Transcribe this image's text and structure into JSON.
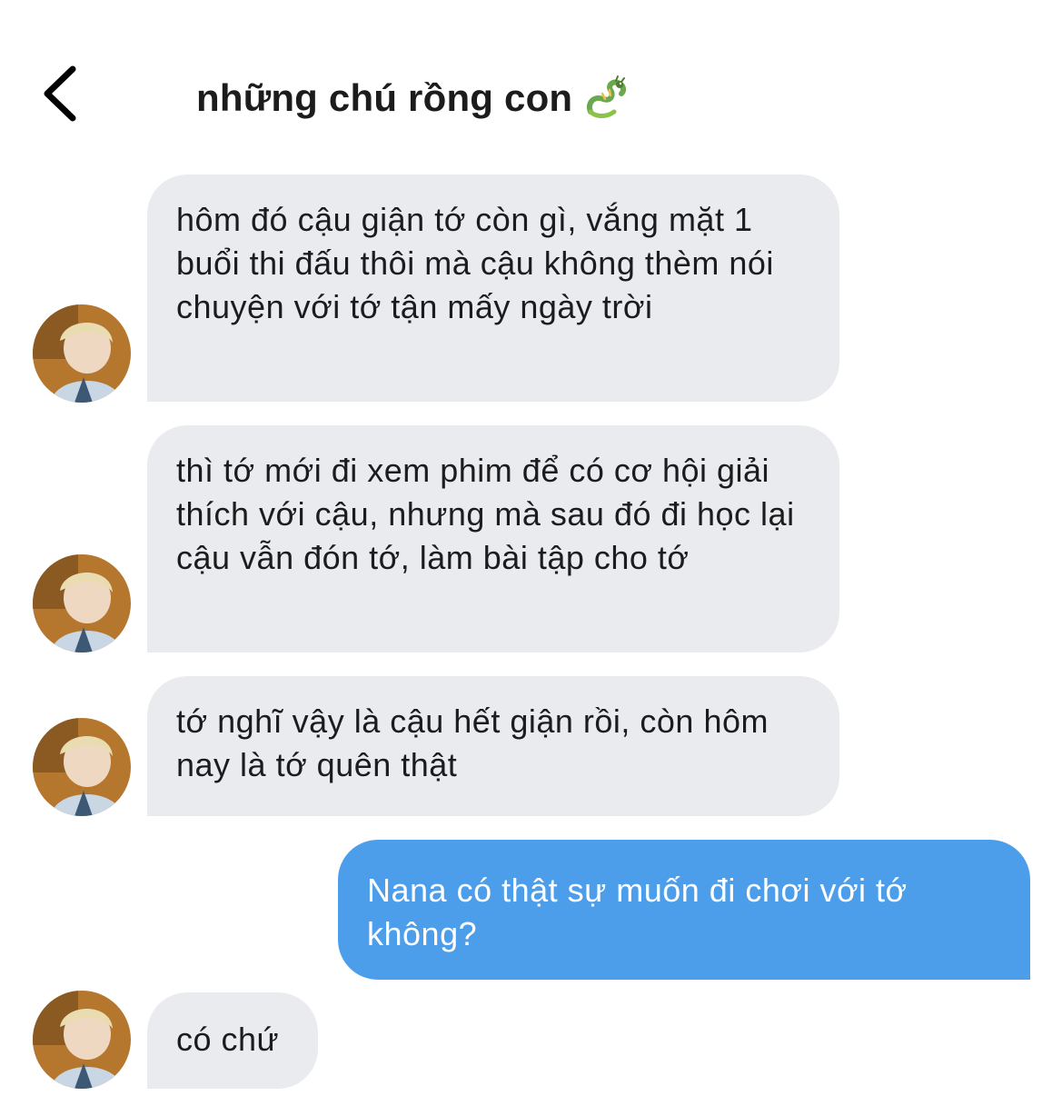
{
  "header": {
    "back_icon": "chevron-left-icon",
    "title": "những chú rồng con",
    "title_emoji": "dragon-icon"
  },
  "messages": [
    {
      "sender": "other",
      "text": "hôm đó cậu giận tớ còn gì, vắng mặt 1 buổi thi đấu thôi mà cậu không thèm nói chuyện với tớ tận mấy ngày trời"
    },
    {
      "sender": "other",
      "text": "thì tớ mới đi xem phim để có cơ hội giải thích với cậu, nhưng mà sau đó đi học lại cậu vẫn đón tớ, làm bài tập cho tớ"
    },
    {
      "sender": "other",
      "text": "tớ nghĩ vậy là cậu hết giận rồi, còn hôm nay là tớ quên thật"
    },
    {
      "sender": "me",
      "text": "Nana có thật sự muốn đi chơi với tớ không?"
    },
    {
      "sender": "other",
      "text": "có chứ"
    }
  ],
  "colors": {
    "incoming_bubble": "#e9ebef",
    "outgoing_bubble": "#4d9eea",
    "text": "#1c1c1e"
  }
}
